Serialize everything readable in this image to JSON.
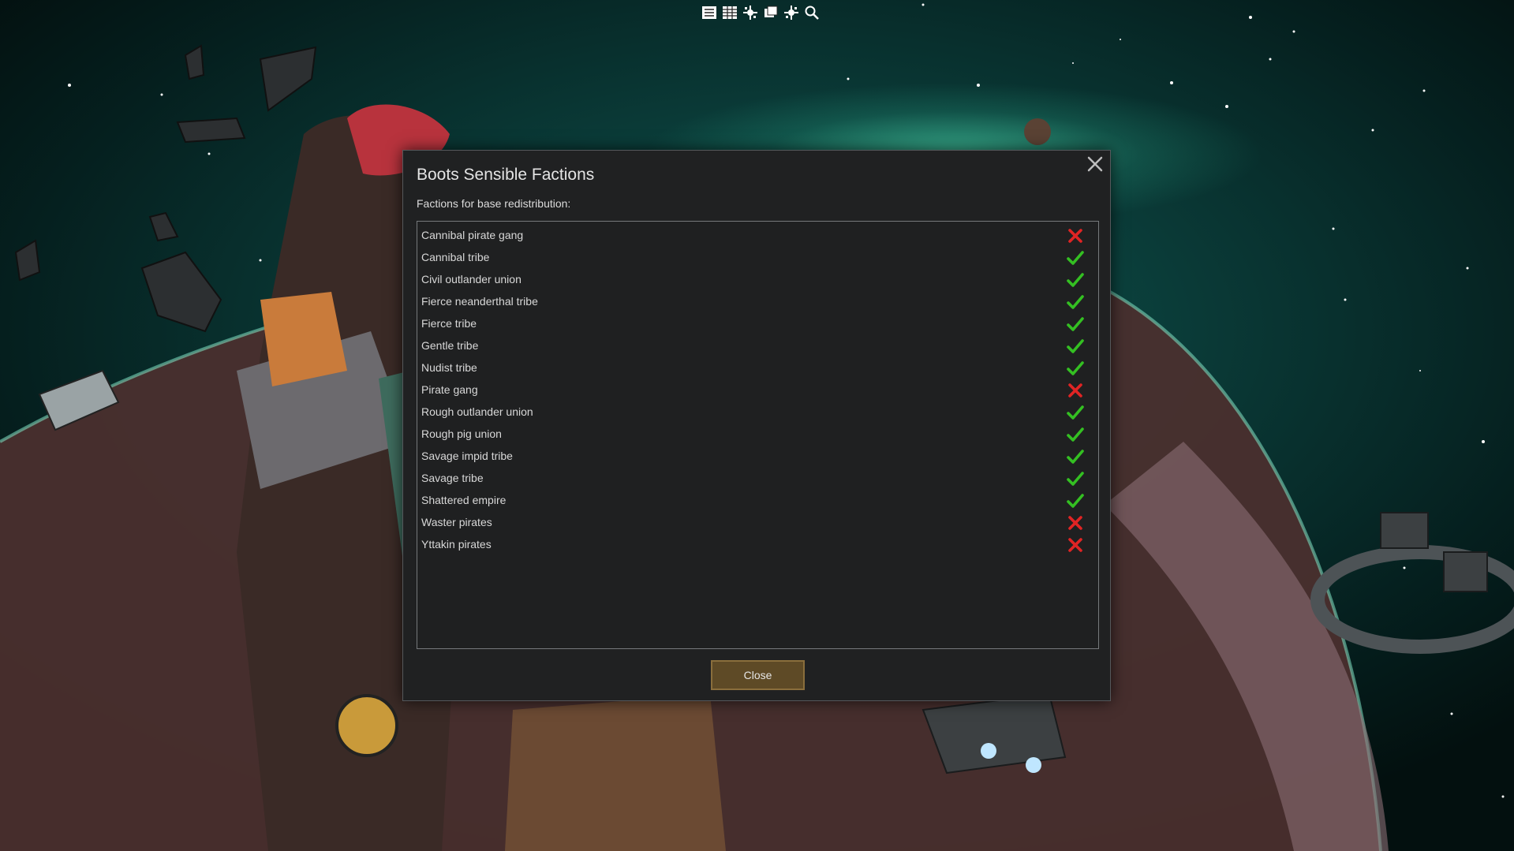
{
  "toolbar": {
    "icons": [
      "list-icon",
      "table-icon",
      "debug-icon",
      "window-icon",
      "debug-settings-icon",
      "search-icon"
    ]
  },
  "dialog": {
    "title": "Boots Sensible Factions",
    "subtitle": "Factions for base redistribution:",
    "close_button_label": "Close",
    "factions": [
      {
        "name": "Cannibal pirate gang",
        "enabled": false
      },
      {
        "name": "Cannibal tribe",
        "enabled": true
      },
      {
        "name": "Civil outlander union",
        "enabled": true
      },
      {
        "name": "Fierce neanderthal tribe",
        "enabled": true
      },
      {
        "name": "Fierce tribe",
        "enabled": true
      },
      {
        "name": "Gentle tribe",
        "enabled": true
      },
      {
        "name": "Nudist tribe",
        "enabled": true
      },
      {
        "name": "Pirate gang",
        "enabled": false
      },
      {
        "name": "Rough outlander union",
        "enabled": true
      },
      {
        "name": "Rough pig union",
        "enabled": true
      },
      {
        "name": "Savage impid tribe",
        "enabled": true
      },
      {
        "name": "Savage tribe",
        "enabled": true
      },
      {
        "name": "Shattered empire",
        "enabled": true
      },
      {
        "name": "Waster pirates",
        "enabled": false
      },
      {
        "name": "Yttakin pirates",
        "enabled": false
      }
    ]
  },
  "colors": {
    "check": "#34c022",
    "cross": "#e02424",
    "button": "#5e4a26",
    "panel": "#202122"
  }
}
